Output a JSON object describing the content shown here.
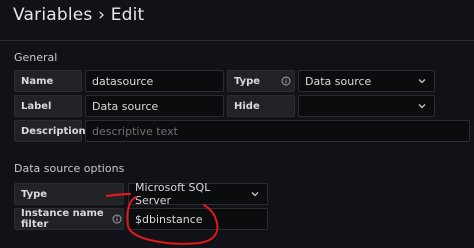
{
  "header": {
    "title": "Variables › Edit"
  },
  "general": {
    "heading": "General",
    "name_label": "Name",
    "name_value": "datasource",
    "type_label": "Type",
    "type_value": "Data source",
    "label_label": "Label",
    "label_value": "Data source",
    "hide_label": "Hide",
    "hide_value": "",
    "description_label": "Description",
    "description_placeholder": "descriptive text"
  },
  "datasource_options": {
    "heading": "Data source options",
    "type_label": "Type",
    "type_value": "Microsoft SQL Server",
    "instance_filter_label": "Instance name filter",
    "instance_filter_value": "$dbinstance"
  },
  "colors": {
    "background": "#111217",
    "label_bg": "#202226",
    "input_bg": "#0b0c0e",
    "annotation": "#e0191f"
  },
  "icons": [
    "info-circle-icon",
    "chevron-down-icon"
  ]
}
